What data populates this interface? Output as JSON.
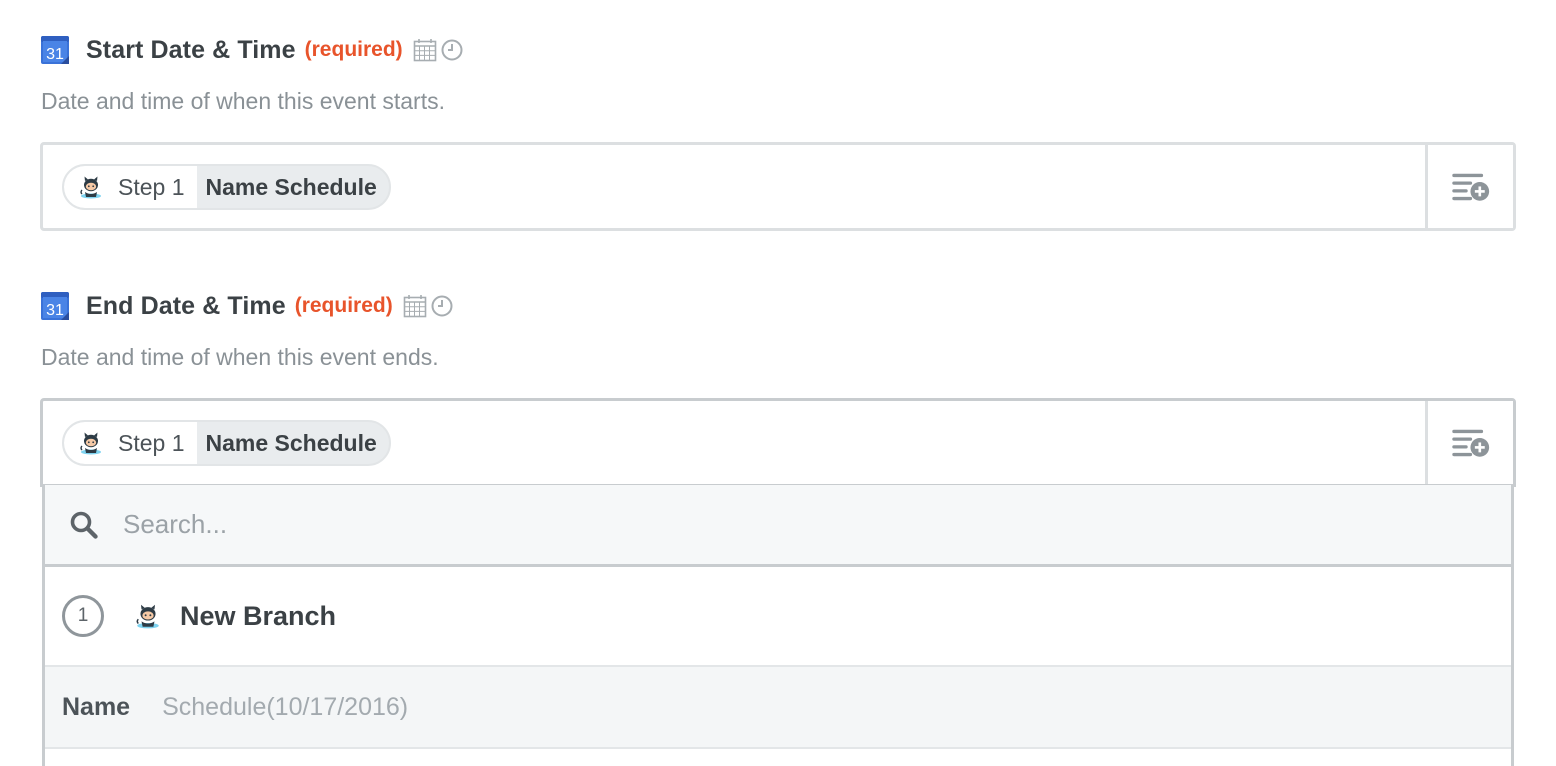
{
  "fields": [
    {
      "label": "Start Date & Time",
      "required": "(required)",
      "description": "Date and time of when this event starts.",
      "app_icon_text": "31",
      "token": {
        "step": "Step 1",
        "value": "Name Schedule"
      }
    },
    {
      "label": "End Date & Time",
      "required": "(required)",
      "description": "Date and time of when this event ends.",
      "app_icon_text": "31",
      "token": {
        "step": "Step 1",
        "value": "Name Schedule"
      }
    }
  ],
  "dropdown": {
    "search_placeholder": "Search...",
    "step": {
      "number": "1",
      "title": "New Branch"
    },
    "rows": [
      {
        "key": "Name",
        "value": "Schedule(10/17/2016)"
      }
    ]
  },
  "colors": {
    "required": "#e8542b",
    "gcal_blue": "#3a72d8",
    "border": "#dcdfe1"
  },
  "icons": {
    "app": "google-calendar-icon",
    "date": "calendar-icon",
    "time": "clock-icon",
    "insert": "insert-field-icon",
    "source_app": "github-octocat-icon",
    "search": "search-icon"
  }
}
